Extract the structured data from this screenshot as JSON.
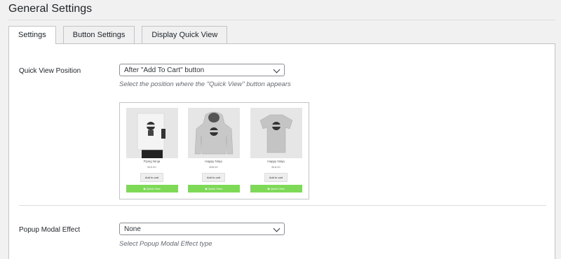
{
  "page": {
    "title": "General Settings"
  },
  "tabs": [
    {
      "label": "Settings",
      "active": true
    },
    {
      "label": "Button Settings",
      "active": false
    },
    {
      "label": "Display Quick View",
      "active": false
    }
  ],
  "quick_view_position": {
    "label": "Quick View Position",
    "selected": "After \"Add To Cart\" button",
    "description": "Select the position where the \"Quick View\" button appears"
  },
  "preview": {
    "products": [
      {
        "name": "Flying Ninja",
        "price": "$15.00",
        "cart_label": "Add to cart",
        "quick_view_label": "◉ Quick View"
      },
      {
        "name": "Happy Ninja",
        "price": "$35.00",
        "cart_label": "Add to cart",
        "quick_view_label": "◉ Quick View"
      },
      {
        "name": "Happy Ninja",
        "price": "$18.00",
        "cart_label": "Add to cart",
        "quick_view_label": "◉ Quick View"
      }
    ],
    "quick_view_color": "#7ed957"
  },
  "popup_modal_effect": {
    "label": "Popup Modal Effect",
    "selected": "None",
    "description": "Select Popup Modal Effect type"
  }
}
